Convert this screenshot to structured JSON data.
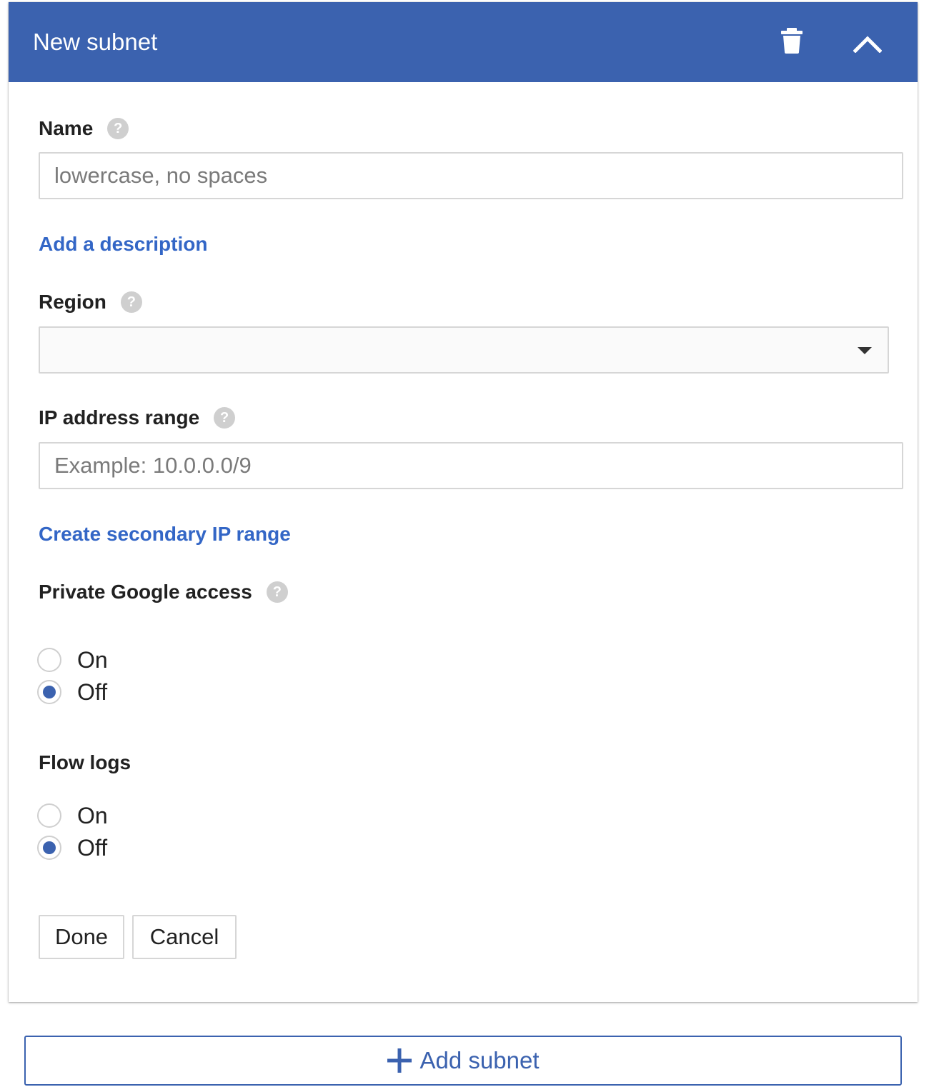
{
  "header": {
    "title": "New subnet",
    "delete_icon": "trash-icon",
    "collapse_icon": "chevron-up-icon",
    "background_color": "#3b62af"
  },
  "form": {
    "name": {
      "label": "Name",
      "placeholder": "lowercase, no spaces",
      "value": ""
    },
    "add_description_link": "Add a description",
    "region": {
      "label": "Region",
      "value": ""
    },
    "ip_range": {
      "label": "IP address range",
      "placeholder": "Example: 10.0.0.0/9",
      "value": ""
    },
    "secondary_range_link": "Create secondary IP range",
    "private_google_access": {
      "label": "Private Google access",
      "options": [
        "On",
        "Off"
      ],
      "selected": "Off"
    },
    "flow_logs": {
      "label": "Flow logs",
      "options": [
        "On",
        "Off"
      ],
      "selected": "Off"
    },
    "done_label": "Done",
    "cancel_label": "Cancel"
  },
  "add_subnet": {
    "label": "Add subnet",
    "icon": "plus-icon"
  },
  "colors": {
    "accent": "#3b62af",
    "link": "#3366c6"
  }
}
